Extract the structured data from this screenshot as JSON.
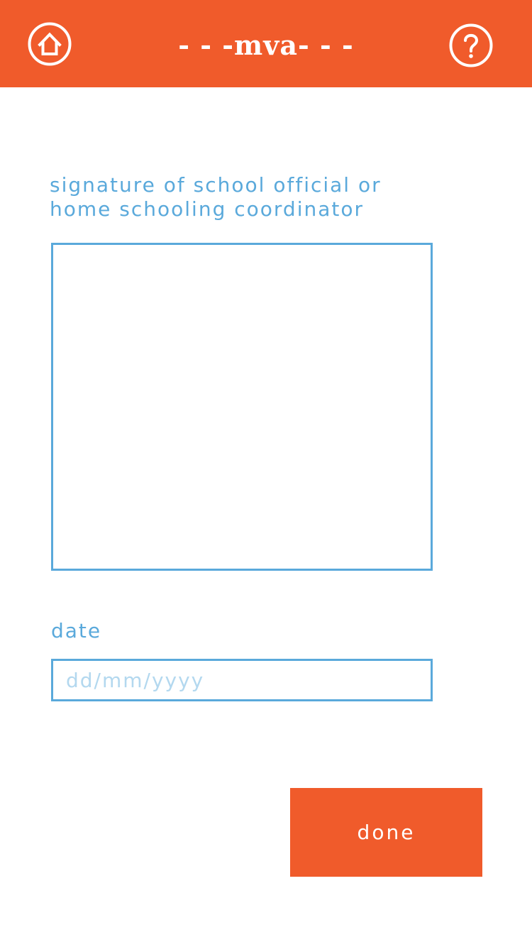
{
  "header": {
    "title": "- - -mva- - -",
    "home_icon": "home-icon",
    "help_icon": "help-icon",
    "background_color": "#f05b2b"
  },
  "form": {
    "signature_label": "signature of school official or home schooling coordinator",
    "date_label": "date",
    "date_value": "",
    "date_placeholder": "dd/mm/yyyy",
    "accent_color": "#5aa9db"
  },
  "actions": {
    "done_label": "done"
  }
}
